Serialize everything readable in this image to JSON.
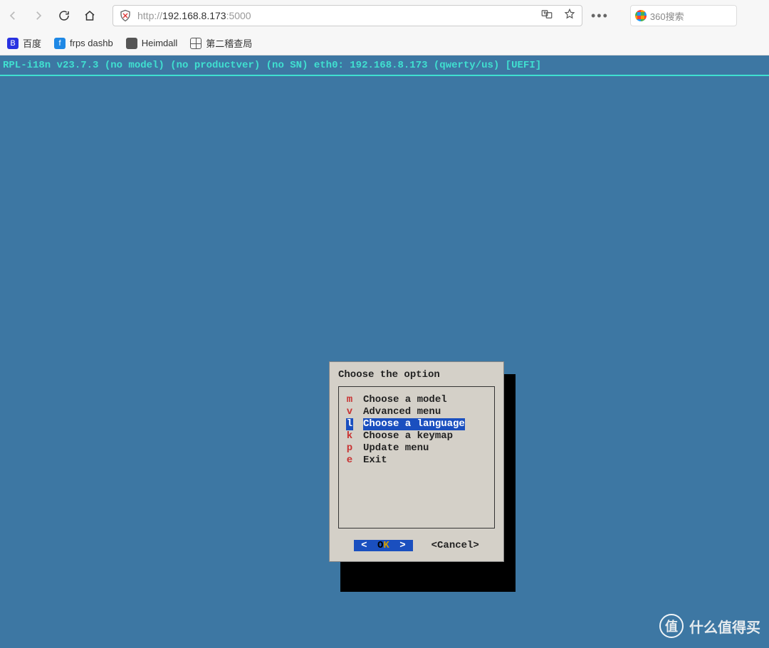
{
  "browser": {
    "url_prefix": "http://",
    "url_host": "192.168.8.173",
    "url_port": ":5000",
    "search_placeholder": "360搜索"
  },
  "bookmarks": [
    {
      "label": "百度"
    },
    {
      "label": "frps dashb"
    },
    {
      "label": "Heimdall"
    },
    {
      "label": "第二稽查局"
    }
  ],
  "terminal": {
    "status": "RPL-i18n v23.7.3 (no model) (no productver) (no SN) eth0: 192.168.8.173 (qwerty/us) [UEFI]"
  },
  "dialog": {
    "title": "Choose the option",
    "options": [
      {
        "key": "m",
        "label": "Choose a model",
        "selected": false
      },
      {
        "key": "v",
        "label": "Advanced menu",
        "selected": false
      },
      {
        "key": "l",
        "label": "Choose a language",
        "selected": true
      },
      {
        "key": "k",
        "label": "Choose a keymap",
        "selected": false
      },
      {
        "key": "p",
        "label": "Update menu",
        "selected": false
      },
      {
        "key": "e",
        "label": "Exit",
        "selected": false
      }
    ],
    "ok_pre": "O",
    "ok_hot": "K",
    "cancel": "<Cancel>"
  },
  "watermark": {
    "badge": "值",
    "text": "什么值得买"
  }
}
